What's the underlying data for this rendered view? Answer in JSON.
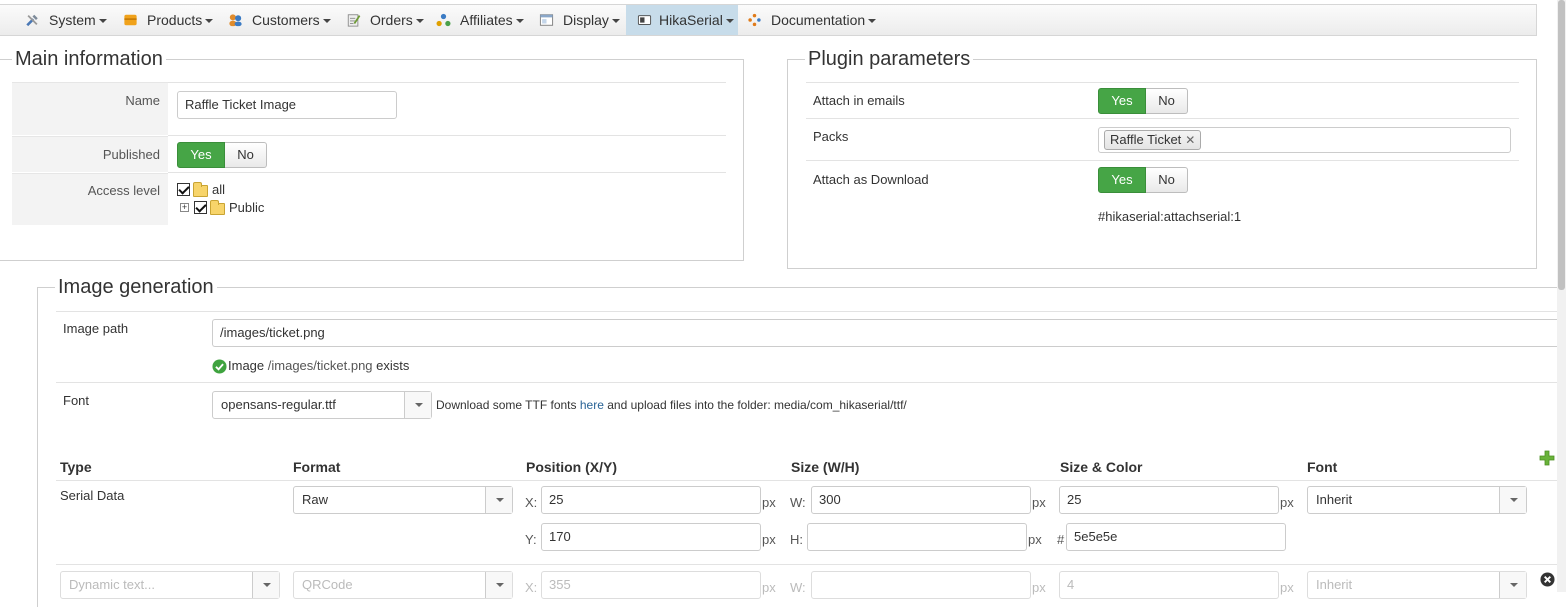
{
  "menu": [
    {
      "label": "System",
      "icon": "tools-icon"
    },
    {
      "label": "Products",
      "icon": "products-icon"
    },
    {
      "label": "Customers",
      "icon": "customers-icon"
    },
    {
      "label": "Orders",
      "icon": "orders-icon"
    },
    {
      "label": "Affiliates",
      "icon": "affiliates-icon"
    },
    {
      "label": "Display",
      "icon": "display-icon"
    },
    {
      "label": "HikaSerial",
      "icon": "hikaserial-icon",
      "active": true
    },
    {
      "label": "Documentation",
      "icon": "documentation-icon"
    }
  ],
  "main_info": {
    "legend": "Main information",
    "name_label": "Name",
    "name_value": "Raffle Ticket Image",
    "published_label": "Published",
    "published": {
      "yes": "Yes",
      "no": "No",
      "selected": "Yes"
    },
    "access_label": "Access level",
    "access_tree": [
      {
        "label": "all",
        "checked": true
      },
      {
        "label": "Public",
        "checked": true
      }
    ]
  },
  "plugin": {
    "legend": "Plugin parameters",
    "attach_emails_label": "Attach in emails",
    "attach_emails": {
      "yes": "Yes",
      "no": "No",
      "selected": "Yes"
    },
    "packs_label": "Packs",
    "packs_tag": "Raffle Ticket",
    "attach_download_label": "Attach as Download",
    "attach_download": {
      "yes": "Yes",
      "no": "No",
      "selected": "Yes"
    },
    "tag_text": "#hikaserial:attachserial:1"
  },
  "image_gen": {
    "legend": "Image generation",
    "path_label": "Image path",
    "path_value": "/images/ticket.png",
    "status_prefix": "Image",
    "status_path": "/images/ticket.png",
    "status_suffix": "exists",
    "font_label": "Font",
    "font_value": "opensans-regular.ttf",
    "font_help_1": "Download some TTF fonts",
    "font_help_link": "here",
    "font_help_2": "and upload files into the folder: media/com_hikaserial/ttf/",
    "columns": [
      "Type",
      "Format",
      "Position (X/Y)",
      "Size (W/H)",
      "Size & Color",
      "Font"
    ],
    "row1": {
      "type": "Serial Data",
      "format": "Raw",
      "x": "25",
      "y": "170",
      "w": "300",
      "h": "",
      "size": "25",
      "color": "5e5e5e",
      "font": "Inherit"
    },
    "row2": {
      "type_placeholder": "Dynamic text...",
      "format": "QRCode",
      "x": "355",
      "size": "4",
      "font": "Inherit"
    },
    "labels": {
      "x": "X:",
      "y": "Y:",
      "w": "W:",
      "h": "H:",
      "px": "px",
      "hash": "#"
    }
  }
}
